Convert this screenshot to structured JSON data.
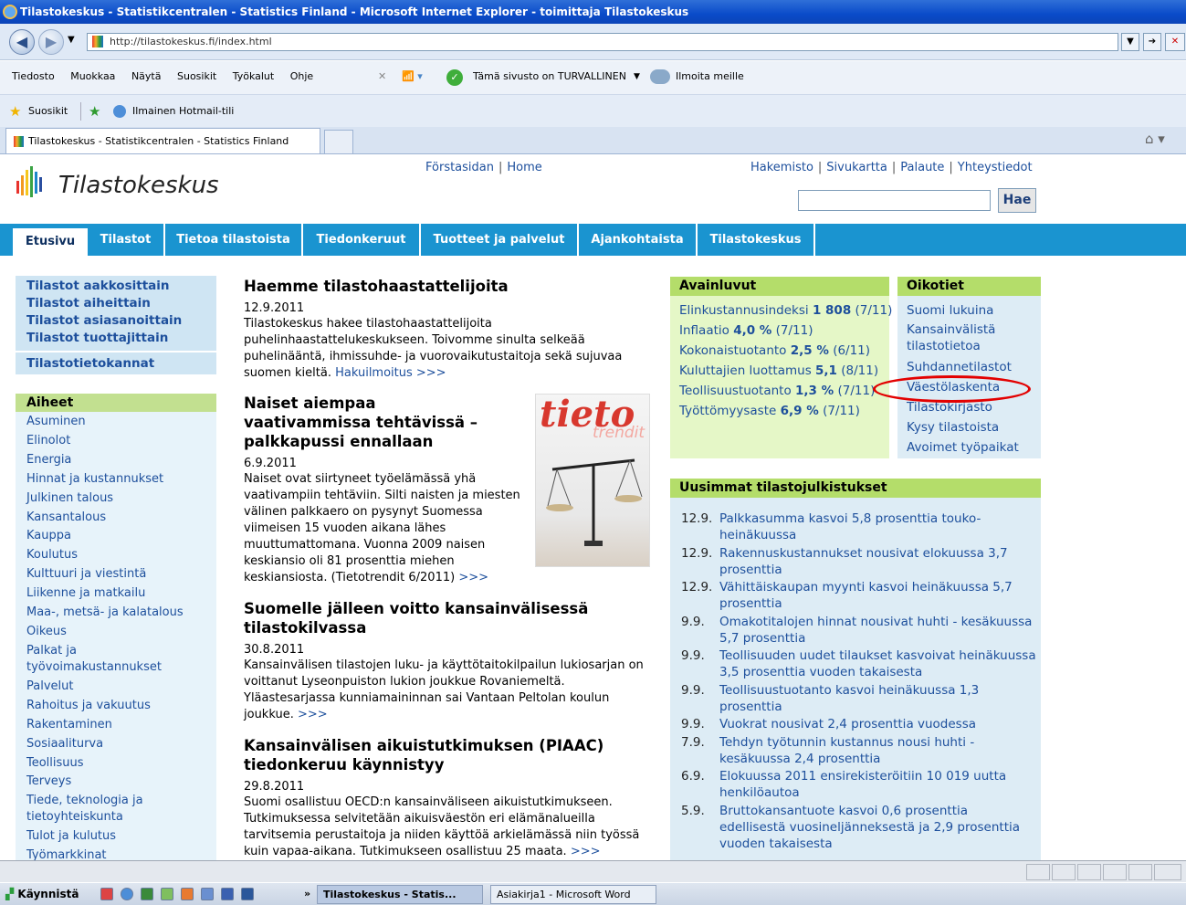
{
  "window": {
    "title": "Tilastokeskus - Statistikcentralen - Statistics Finland - Microsoft Internet Explorer - toimittaja Tilastokeskus"
  },
  "address": {
    "url": "http://tilastokeskus.fi/index.html"
  },
  "menu": {
    "items": [
      "Tiedosto",
      "Muokkaa",
      "Näytä",
      "Suosikit",
      "Työkalut",
      "Ohje"
    ],
    "security": "Tämä sivusto on TURVALLINEN",
    "report": "Ilmoita meille"
  },
  "favorites": {
    "label": "Suosikit",
    "hotmail": "Ilmainen Hotmail-tili"
  },
  "tab": {
    "title": "Tilastokeskus - Statistikcentralen - Statistics Finland"
  },
  "site": {
    "logo": "Tilastokeskus",
    "toplinks_a": [
      "Förstasidan",
      "Home"
    ],
    "toplinks_b": [
      "Hakemisto",
      "Sivukartta",
      "Palaute",
      "Yhteystiedot"
    ],
    "search_button": "Hae",
    "nav": [
      "Etusivu",
      "Tilastot",
      "Tietoa tilastoista",
      "Tiedonkeruut",
      "Tuotteet ja palvelut",
      "Ajankohtaista",
      "Tilastokeskus"
    ]
  },
  "left": {
    "box1": [
      "Tilastot aakkosittain",
      "Tilastot aiheittain",
      "Tilastot asiasanoittain",
      "Tilastot tuottajittain"
    ],
    "box2": "Tilastotietokannat",
    "aiheet_title": "Aiheet",
    "aiheet": [
      "Asuminen",
      "Elinolot",
      "Energia",
      "Hinnat ja kustannukset",
      "Julkinen talous",
      "Kansantalous",
      "Kauppa",
      "Koulutus",
      "Kulttuuri ja viestintä",
      "Liikenne ja matkailu",
      "Maa-, metsä- ja kalatalous",
      "Oikeus",
      "Palkat ja työvoimakustannukset",
      "Palvelut",
      "Rahoitus ja vakuutus",
      "Rakentaminen",
      "Sosiaaliturva",
      "Teollisuus",
      "Terveys",
      "Tiede, teknologia ja tietoyhteiskunta",
      "Tulot ja kulutus",
      "Työmarkkinat"
    ]
  },
  "news": [
    {
      "title": "Haemme tilastohaastattelijoita",
      "date": "12.9.2011",
      "text": "Tilastokeskus hakee tilastohaastattelijoita puhelinhaastattelukeskukseen. Toivomme sinulta selkeää puhelinääntä, ihmissuhde- ja vuorovaikutustaitoja sekä sujuvaa suomen kieltä.",
      "link": "Hakuilmoitus >>>"
    },
    {
      "title": "Naiset aiempaa vaativammissa tehtävissä – palkkapussi ennallaan",
      "date": "6.9.2011",
      "text": "Naiset ovat siirtyneet työelämässä yhä vaativampiin tehtäviin. Silti naisten ja miesten välinen palkkaero on pysynyt Suomessa viimeisen 15 vuoden aikana lähes muuttumattomana. Vuonna 2009 naisen keskiansio oli 81 prosenttia miehen keskiansiosta. (Tietotrendit 6/2011)",
      "link": ">>>"
    },
    {
      "title": "Suomelle jälleen voitto kansainvälisessä tilastokilvassa",
      "date": "30.8.2011",
      "text": "Kansainvälisen tilastojen luku- ja käyttötaitokilpailun lukiosarjan on voittanut Lyseonpuiston lukion joukkue Rovaniemeltä. Yläastesarjassa kunniamaininnan sai Vantaan Peltolan koulun joukkue.",
      "link": ">>>"
    },
    {
      "title": "Kansainvälisen aikuistutkimuksen (PIAAC) tiedonkeruu käynnistyy",
      "date": "29.8.2011",
      "text": "Suomi osallistuu OECD:n kansainväliseen aikuistutkimukseen. Tutkimuksessa selvitetään aikuisväestön eri elämänalueilla tarvitsemia perustaitoja ja niiden käyttöä arkielämässä niin työssä kuin vapaa-aikana. Tutkimukseen osallistuu 25 maata.",
      "link": ">>>"
    }
  ],
  "tieto_image": {
    "word1": "tieto",
    "word2": "trendit"
  },
  "avainluvut": {
    "title": "Avainluvut",
    "items": [
      {
        "label": "Elinkustannusindeksi",
        "value": "1 808",
        "period": "(7/11)"
      },
      {
        "label": "Inflaatio",
        "value": "4,0 %",
        "period": "(7/11)"
      },
      {
        "label": "Kokonaistuotanto",
        "value": "2,5 %",
        "period": "(6/11)"
      },
      {
        "label": "Kuluttajien luottamus",
        "value": "5,1",
        "period": "(8/11)"
      },
      {
        "label": "Teollisuustuotanto",
        "value": "1,3 %",
        "period": "(7/11)"
      },
      {
        "label": "Työttömyysaste",
        "value": "6,9 %",
        "period": "(7/11)"
      }
    ]
  },
  "oikotiet": {
    "title": "Oikotiet",
    "items": [
      "Suomi lukuina",
      "Kansainvälistä tilastotietoa",
      "Suhdannetilastot",
      "Väestölaskenta",
      "Tilastokirjasto",
      "Kysy tilastoista",
      "Avoimet työpaikat"
    ]
  },
  "uusimmat": {
    "title": "Uusimmat tilastojulkistukset",
    "items": [
      {
        "date": "12.9.",
        "text": "Palkkasumma kasvoi 5,8 prosenttia touko-heinäkuussa"
      },
      {
        "date": "12.9.",
        "text": "Rakennuskustannukset nousivat elokuussa 3,7 prosenttia"
      },
      {
        "date": "12.9.",
        "text": "Vähittäiskaupan myynti kasvoi heinäkuussa 5,7 prosenttia"
      },
      {
        "date": "9.9.",
        "text": "Omakotitalojen hinnat nousivat huhti - kesäkuussa 5,7 prosenttia"
      },
      {
        "date": "9.9.",
        "text": "Teollisuuden uudet tilaukset kasvoivat heinäkuussa 3,5 prosenttia vuoden takaisesta"
      },
      {
        "date": "9.9.",
        "text": "Teollisuustuotanto kasvoi heinäkuussa 1,3 prosenttia"
      },
      {
        "date": "9.9.",
        "text": "Vuokrat nousivat 2,4 prosenttia vuodessa"
      },
      {
        "date": "7.9.",
        "text": "Tehdyn työtunnin kustannus nousi huhti - kesäkuussa 2,4 prosenttia"
      },
      {
        "date": "6.9.",
        "text": "Elokuussa 2011 ensirekisteröitiin 10 019 uutta henkilöautoa"
      },
      {
        "date": "5.9.",
        "text": "Bruttokansantuote kasvoi 0,6 prosenttia edellisestä vuosineljänneksestä ja 2,9 prosenttia vuoden takaisesta"
      }
    ]
  },
  "taskbar": {
    "start": "Käynnistä",
    "task1": "Tilastokeskus - Statis...",
    "task2": "Asiakirja1 - Microsoft Word"
  },
  "colors": {
    "nav": "#1a94d0",
    "green_head": "#b4dd6a",
    "highlight": "#e30000"
  }
}
